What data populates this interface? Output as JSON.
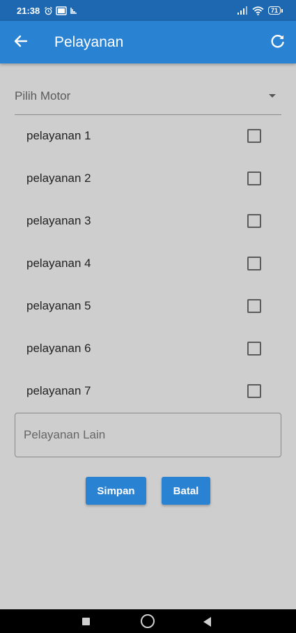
{
  "status_bar": {
    "time": "21:38",
    "battery": "71"
  },
  "app_bar": {
    "title": "Pelayanan"
  },
  "form": {
    "motor_dropdown_label": "Pilih Motor",
    "services": [
      {
        "label": "pelayanan 1",
        "checked": false
      },
      {
        "label": "pelayanan 2",
        "checked": false
      },
      {
        "label": "pelayanan 3",
        "checked": false
      },
      {
        "label": "pelayanan 4",
        "checked": false
      },
      {
        "label": "pelayanan 5",
        "checked": false
      },
      {
        "label": "pelayanan 6",
        "checked": false
      },
      {
        "label": "pelayanan 7",
        "checked": false
      }
    ],
    "other_service_placeholder": "Pelayanan Lain",
    "other_service_value": ""
  },
  "actions": {
    "save_label": "Simpan",
    "cancel_label": "Batal"
  },
  "colors": {
    "primary": "#2a82d3",
    "status_bar": "#1d68b1",
    "background": "#cecece"
  }
}
